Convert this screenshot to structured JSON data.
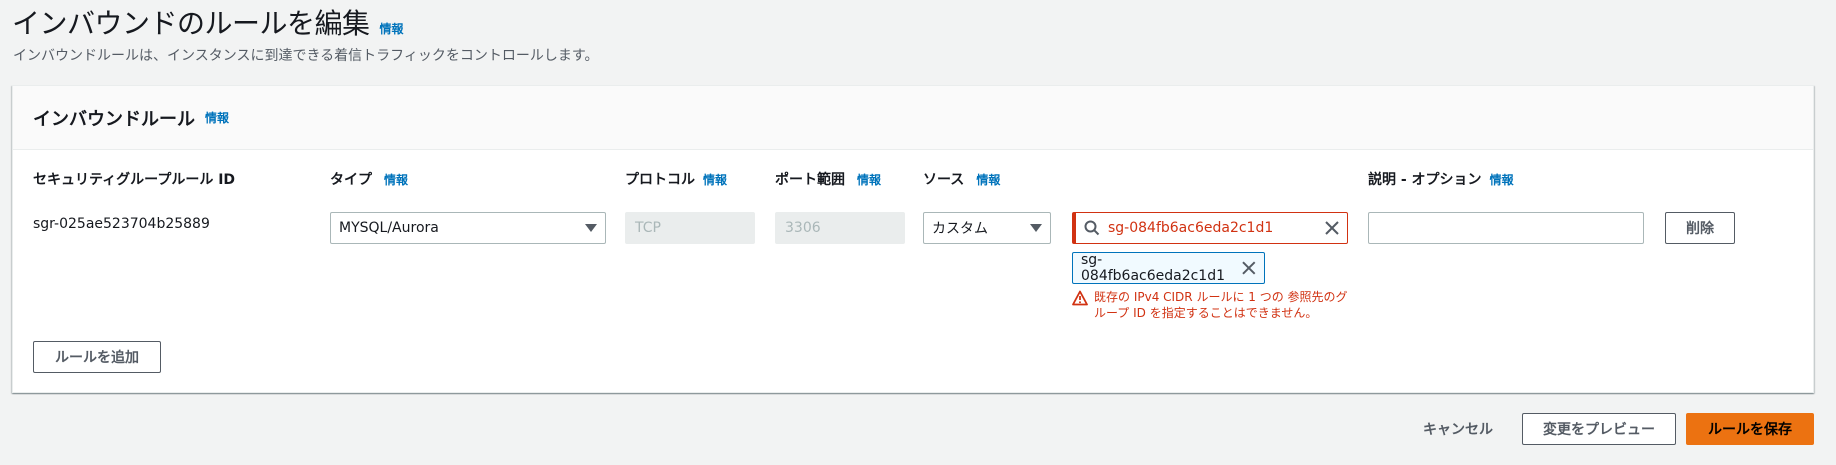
{
  "page": {
    "title": "インバウンドのルールを編集",
    "title_info": "情報",
    "description": "インバウンドルールは、インスタンスに到達できる着信トラフィックをコントロールします。"
  },
  "panel": {
    "title": "インバウンドルール",
    "title_info": "情報",
    "columns": {
      "rule_id": "セキュリティグループルール ID",
      "type": "タイプ",
      "type_info": "情報",
      "protocol": "プロトコル",
      "protocol_info": "情報",
      "port_range": "ポート範囲",
      "port_range_info": "情報",
      "source": "ソース",
      "source_info": "情報",
      "description": "説明 - オプション",
      "description_info": "情報"
    },
    "rule": {
      "id": "sgr-025ae523704b25889",
      "type": "MYSQL/Aurora",
      "protocol": "TCP",
      "port_range": "3306",
      "source_type": "カスタム",
      "source_search_value": "sg-084fb6ac6eda2c1d1",
      "source_token": "sg-084fb6ac6eda2c1d1",
      "error_message": "既存の IPv4 CIDR ルールに 1 つの 参照先のグループ ID を指定することはできません。",
      "description_value": "",
      "delete_label": "削除"
    },
    "add_rule_label": "ルールを追加"
  },
  "footer": {
    "cancel_label": "キャンセル",
    "preview_label": "変更をプレビュー",
    "save_label": "ルールを保存"
  },
  "colors": {
    "accent_link": "#0073bb",
    "error": "#d13212",
    "primary_button": "#ec7211",
    "background": "#f2f3f3"
  },
  "icons": {
    "search": "search-icon",
    "close": "close-icon",
    "dropdown": "caret-down-icon",
    "warning": "warning-icon"
  }
}
